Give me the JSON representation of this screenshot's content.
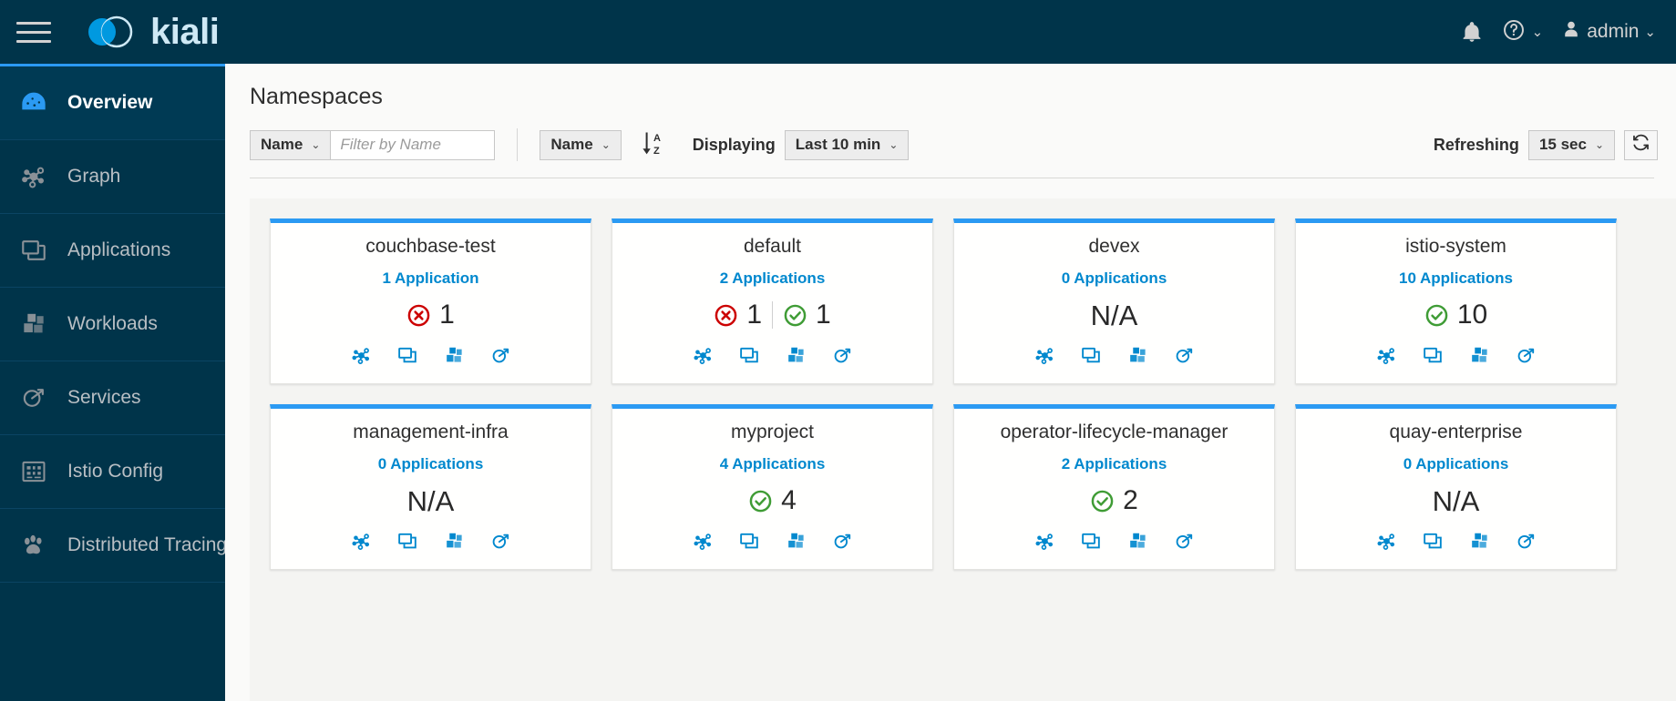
{
  "masthead": {
    "brand_name": "kiali",
    "menu_label": "menu-toggle",
    "notifications_label": "Notifications",
    "help_label": "Help",
    "user_name": "admin"
  },
  "sidebar": {
    "items": [
      {
        "label": "Overview",
        "icon": "dashboard-icon",
        "active": true
      },
      {
        "label": "Graph",
        "icon": "graph-icon",
        "active": false
      },
      {
        "label": "Applications",
        "icon": "applications-icon",
        "active": false
      },
      {
        "label": "Workloads",
        "icon": "workloads-icon",
        "active": false
      },
      {
        "label": "Services",
        "icon": "services-icon",
        "active": false
      },
      {
        "label": "Istio Config",
        "icon": "istio-config-icon",
        "active": false
      },
      {
        "label": "Distributed Tracing",
        "icon": "tracing-icon",
        "active": false
      }
    ]
  },
  "page": {
    "title": "Namespaces"
  },
  "toolbar": {
    "filter_type": "Name",
    "filter_placeholder": "Filter by Name",
    "filter_value": "",
    "sort_by": "Name",
    "sort_direction_icon": "sort-ascending-alpha-icon",
    "displaying_label": "Displaying",
    "duration": "Last 10 min",
    "refreshing_label": "Refreshing",
    "refresh_interval": "15 sec",
    "refresh_icon": "sync-icon"
  },
  "colors": {
    "accent_blue": "#2b9af3",
    "link_blue": "#0088ce",
    "masthead_bg": "#00344a",
    "healthy_green": "#3f9c35",
    "failure_red": "#cc0000",
    "grid_bg": "#f4f4f2"
  },
  "namespaces": [
    {
      "name": "couchbase-test",
      "apps_label": "1 Application",
      "health": [
        {
          "status": "failure",
          "count": "1"
        }
      ],
      "actions": [
        "graph-icon",
        "applications-icon",
        "workloads-icon",
        "services-icon"
      ]
    },
    {
      "name": "default",
      "apps_label": "2 Applications",
      "health": [
        {
          "status": "failure",
          "count": "1"
        },
        {
          "status": "healthy",
          "count": "1"
        }
      ],
      "actions": [
        "graph-icon",
        "applications-icon",
        "workloads-icon",
        "services-icon"
      ]
    },
    {
      "name": "devex",
      "apps_label": "0 Applications",
      "health": [
        {
          "status": "na",
          "count": "N/A"
        }
      ],
      "actions": [
        "graph-icon",
        "applications-icon",
        "workloads-icon",
        "services-icon"
      ]
    },
    {
      "name": "istio-system",
      "apps_label": "10 Applications",
      "health": [
        {
          "status": "healthy",
          "count": "10"
        }
      ],
      "actions": [
        "graph-icon",
        "applications-icon",
        "workloads-icon",
        "services-icon"
      ]
    },
    {
      "name": "management-infra",
      "apps_label": "0 Applications",
      "health": [
        {
          "status": "na",
          "count": "N/A"
        }
      ],
      "actions": [
        "graph-icon",
        "applications-icon",
        "workloads-icon",
        "services-icon"
      ]
    },
    {
      "name": "myproject",
      "apps_label": "4 Applications",
      "health": [
        {
          "status": "healthy",
          "count": "4"
        }
      ],
      "actions": [
        "graph-icon",
        "applications-icon",
        "workloads-icon",
        "services-icon"
      ]
    },
    {
      "name": "operator-lifecycle-manager",
      "apps_label": "2 Applications",
      "health": [
        {
          "status": "healthy",
          "count": "2"
        }
      ],
      "actions": [
        "graph-icon",
        "applications-icon",
        "workloads-icon",
        "services-icon"
      ]
    },
    {
      "name": "quay-enterprise",
      "apps_label": "0 Applications",
      "health": [
        {
          "status": "na",
          "count": "N/A"
        }
      ],
      "actions": [
        "graph-icon",
        "applications-icon",
        "workloads-icon",
        "services-icon"
      ]
    }
  ]
}
